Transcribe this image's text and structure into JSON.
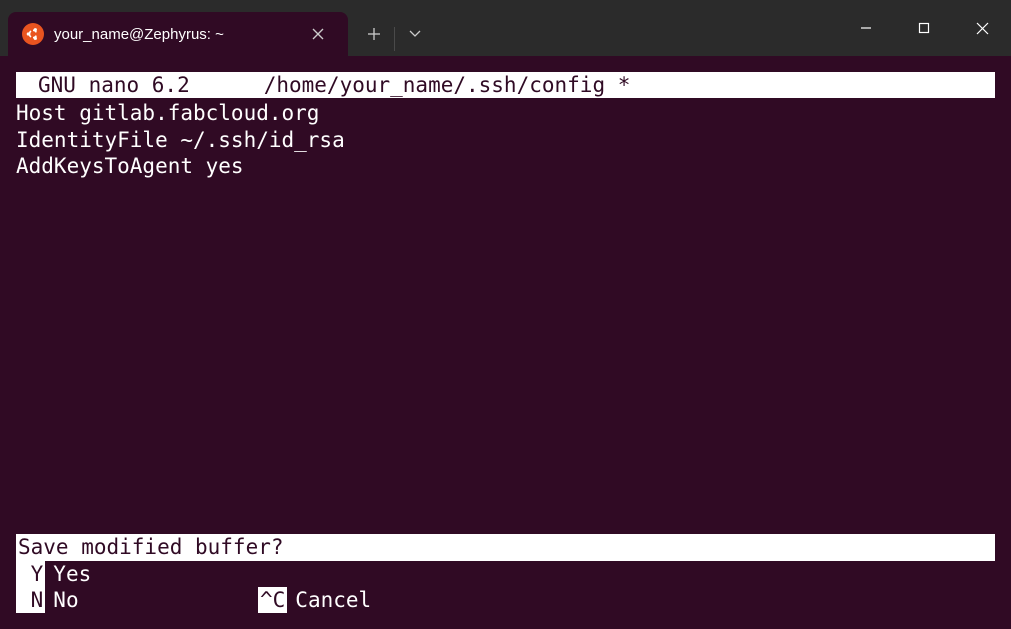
{
  "window": {
    "tab_title": "your_name@Zephyrus: ~"
  },
  "nano": {
    "app_name": "GNU nano 6.2",
    "file_path": "/home/your_name/.ssh/config *",
    "content_lines": [
      "Host gitlab.fabcloud.org",
      "IdentityFile ~/.ssh/id_rsa",
      "AddKeysToAgent yes"
    ],
    "prompt": "Save modified buffer?",
    "shortcuts": {
      "yes_key": " Y",
      "yes_label": "Yes",
      "no_key": " N",
      "no_label": "No",
      "cancel_key": "^C",
      "cancel_label": "Cancel"
    }
  }
}
